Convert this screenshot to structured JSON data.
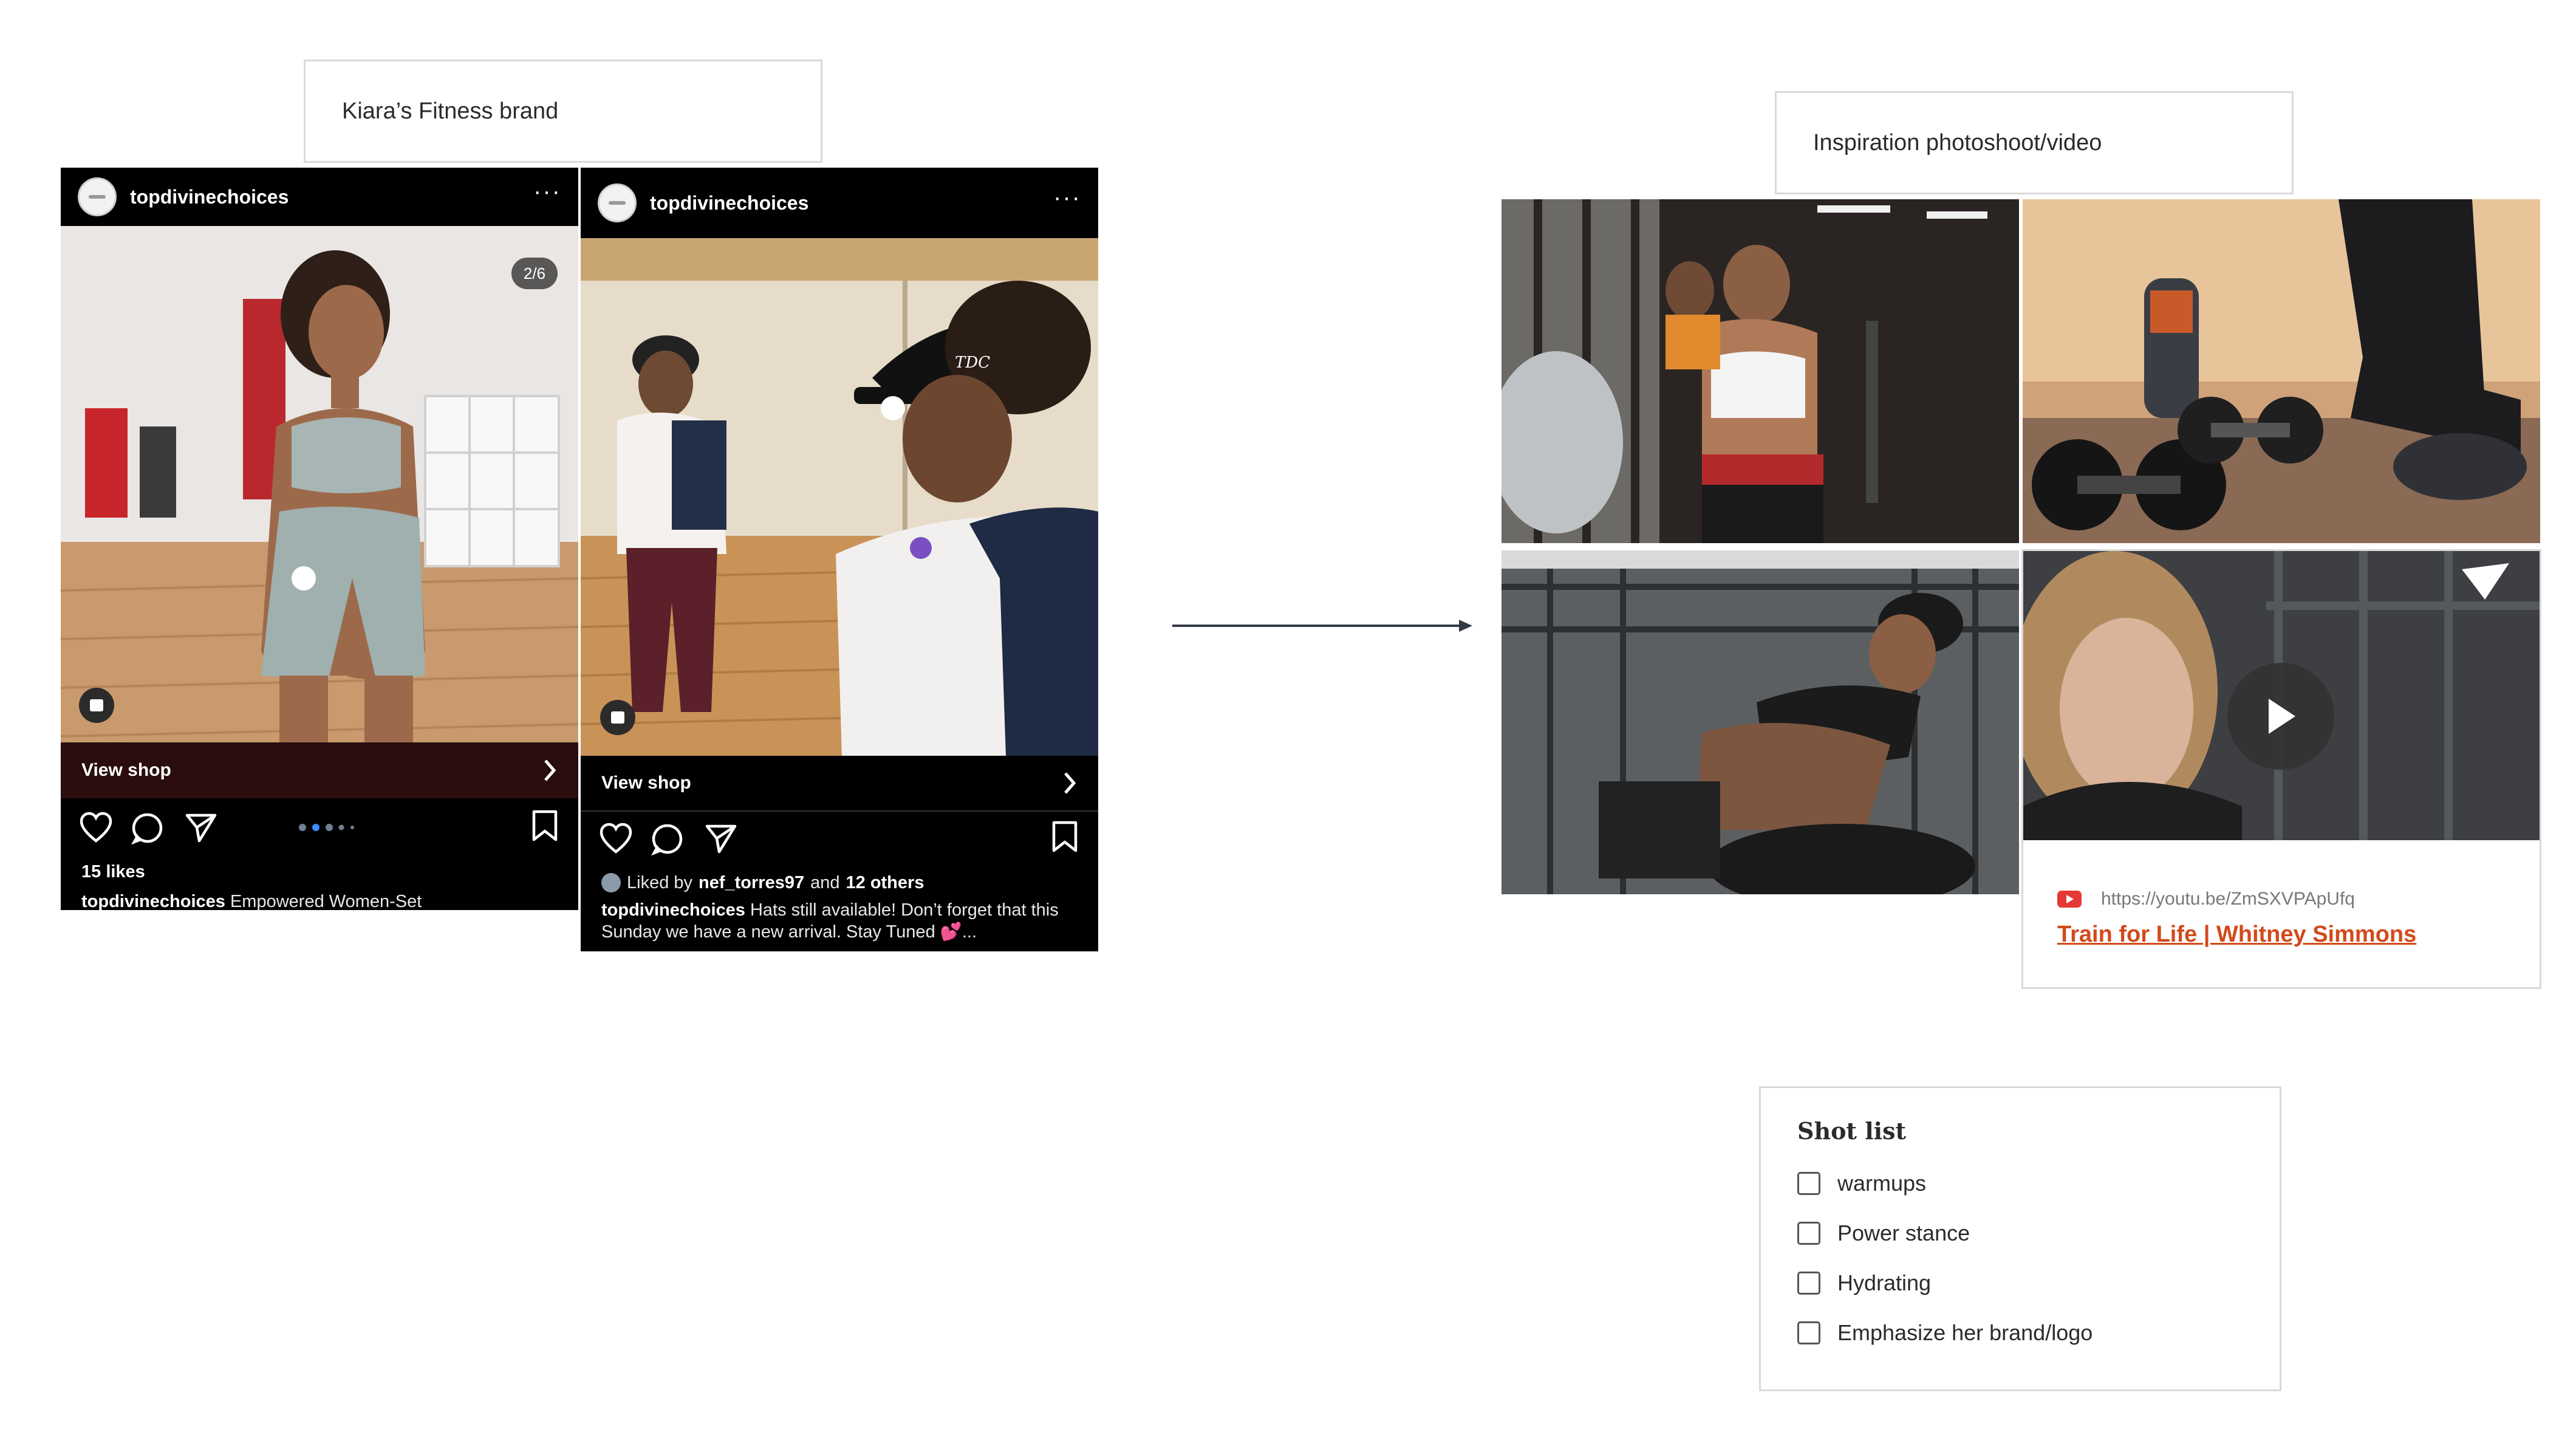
{
  "notes": {
    "brand": "Kiara’s Fitness brand",
    "inspiration": "Inspiration photoshoot/video"
  },
  "posts": [
    {
      "username": "topdivinechoices",
      "more": "···",
      "counter": "2/6",
      "photo_overlay": "",
      "view_shop": "View shop",
      "likes": "15 likes",
      "caption_user": "topdivinechoices",
      "caption_text": "Empowered Women-Set"
    },
    {
      "username": "topdivinechoices",
      "more": "···",
      "photo_overlay": "TDC",
      "view_shop": "View shop",
      "liked_by_prefix": "Liked by",
      "liked_by_user": "nef_torres97",
      "liked_by_and": "and",
      "liked_by_others": "12 others",
      "caption_user": "topdivinechoices",
      "caption_text": "Hats still available! Don’t forget that this Sunday we have a new arrival. Stay Tuned 💕..."
    }
  ],
  "youtube": {
    "url": "https://youtu.be/ZmSXVPApUfq",
    "title": "Train for Life | Whitney Simmons"
  },
  "shot_list": {
    "title": "Shot list",
    "items": [
      {
        "label": "warmups",
        "checked": false
      },
      {
        "label": "Power stance",
        "checked": false
      },
      {
        "label": "Hydrating",
        "checked": false
      },
      {
        "label": "Emphasize her brand/logo",
        "checked": false
      }
    ]
  },
  "colors": {
    "accent_link": "#d24a1c",
    "youtube_red": "#e53935",
    "card_border": "#d9d9d9"
  }
}
